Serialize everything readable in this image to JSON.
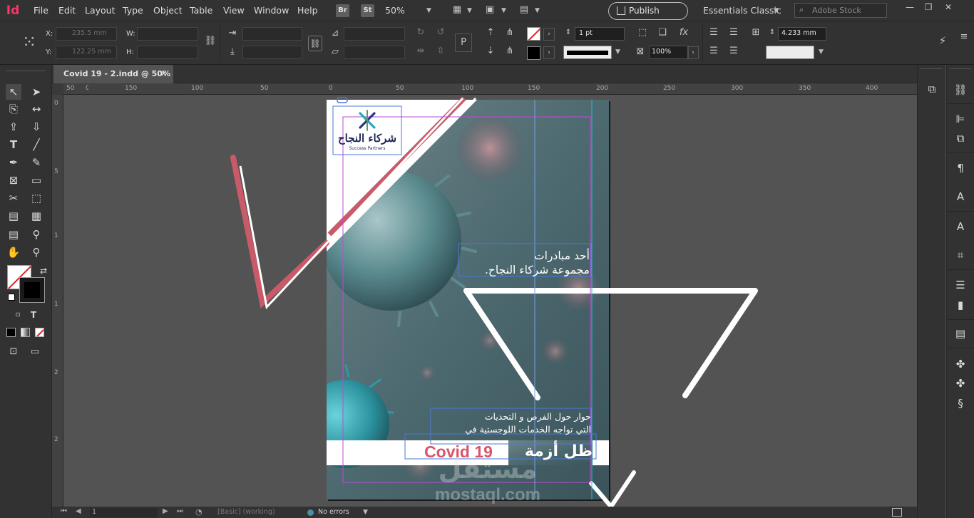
{
  "app": {
    "logo": "Id"
  },
  "menu": {
    "items": [
      "File",
      "Edit",
      "Layout",
      "Type",
      "Object",
      "Table",
      "View",
      "Window",
      "Help"
    ],
    "bridge_badge": "Br",
    "stock_badge": "St",
    "zoom": "50%",
    "publish_label": "Publish Online",
    "workspace": "Essentials Classic",
    "stock_search_placeholder": "Adobe Stock"
  },
  "control": {
    "x_label": "X:",
    "y_label": "Y:",
    "w_label": "W:",
    "h_label": "H:",
    "x_value": "235.5 mm",
    "y_value": "122.25 mm",
    "stroke_weight": "1 pt",
    "scale_value": "100%",
    "column_gutter": "4.233 mm"
  },
  "document": {
    "tab_title": "Covid 19 - 2.indd @ 50%",
    "logo_text_ar": "شركاء النجاح",
    "logo_text_en": "Success Partners",
    "text_block_1": [
      "أحد مبادرات",
      "مجموعة شركاء النجاح."
    ],
    "text_block_2": [
      "حوار حول الفرص و التحديات",
      "التي تواجه الخدمات اللوجستية في"
    ],
    "headline_ar": "ظل أزمة",
    "headline_en": "Covid 19"
  },
  "watermark": {
    "arabic": "مستقل",
    "latin": "mostaql.com"
  },
  "rulers": {
    "h_ticks": [
      "50",
      "0",
      "150",
      "100",
      "50",
      "0",
      "50",
      "100",
      "150",
      "200",
      "250",
      "300",
      "350",
      "400"
    ],
    "v_ticks": [
      "0",
      "5",
      "1",
      "1",
      "2",
      "2"
    ]
  },
  "status": {
    "page_number": "1",
    "preflight_profile": "[Basic] (working)",
    "preflight_result": "No errors"
  },
  "colors": {
    "accent_pink": "#c85a6a",
    "frame_purple": "#b94dd6",
    "frame_cyan": "#2ab8d8",
    "headline_red": "#d9556a",
    "publish_border": "#bbbbbb"
  }
}
